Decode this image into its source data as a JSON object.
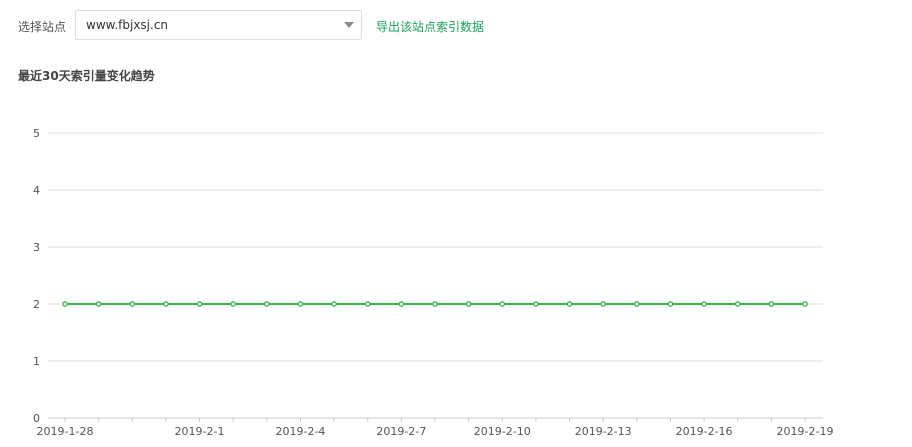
{
  "toolbar": {
    "site_label": "选择站点",
    "site_select": {
      "value": "www.fbjxsj.cn"
    },
    "export_link": "导出该站点索引数据"
  },
  "chart_title": "最近30天索引量变化趋势",
  "colors": {
    "accent": "#1aa05b",
    "series": "#39b54a",
    "grid": "#dddddd"
  },
  "icons": {
    "select_caret": "chevron-down-icon"
  },
  "chart_data": {
    "type": "line",
    "x": [
      "2019-1-28",
      "2019-1-29",
      "2019-1-30",
      "2019-1-31",
      "2019-2-1",
      "2019-2-2",
      "2019-2-3",
      "2019-2-4",
      "2019-2-5",
      "2019-2-6",
      "2019-2-7",
      "2019-2-8",
      "2019-2-9",
      "2019-2-10",
      "2019-2-11",
      "2019-2-12",
      "2019-2-13",
      "2019-2-14",
      "2019-2-15",
      "2019-2-16",
      "2019-2-17",
      "2019-2-18",
      "2019-2-19"
    ],
    "x_tick_labels": [
      "2019-1-28",
      "2019-2-1",
      "2019-2-4",
      "2019-2-7",
      "2019-2-10",
      "2019-2-13",
      "2019-2-16",
      "2019-2-19"
    ],
    "series": [
      {
        "values": [
          2,
          2,
          2,
          2,
          2,
          2,
          2,
          2,
          2,
          2,
          2,
          2,
          2,
          2,
          2,
          2,
          2,
          2,
          2,
          2,
          2,
          2,
          2
        ]
      }
    ],
    "y_ticks": [
      0,
      1,
      2,
      3,
      4,
      5
    ],
    "ylim": [
      0,
      5
    ],
    "grid": true,
    "legend": "none"
  }
}
